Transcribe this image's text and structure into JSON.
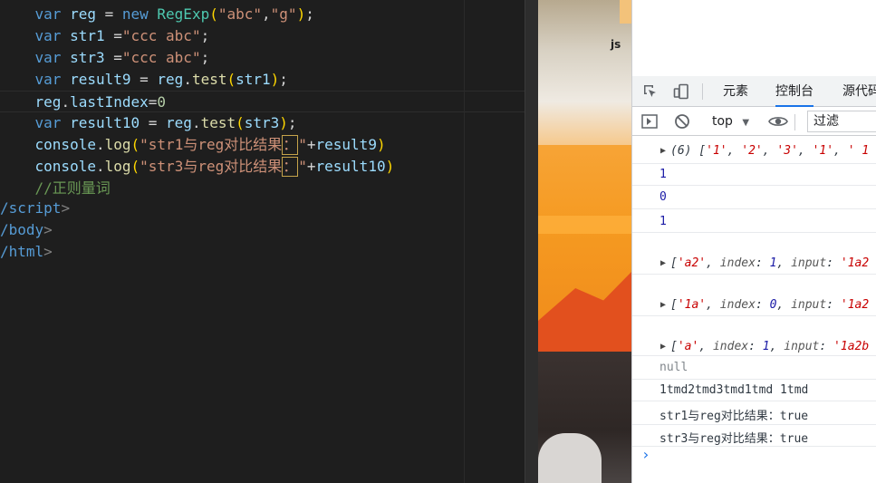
{
  "editor": {
    "lines": [
      {
        "tokens": [
          {
            "t": "    ",
            "c": "ws"
          },
          {
            "t": "var",
            "c": "kw"
          },
          {
            "t": " reg ",
            "c": "var"
          },
          {
            "t": "= ",
            "c": "op"
          },
          {
            "t": "new ",
            "c": "kw"
          },
          {
            "t": "RegExp",
            "c": "cls"
          },
          {
            "t": "(",
            "c": "br"
          },
          {
            "t": "\"abc\"",
            "c": "str"
          },
          {
            "t": ",",
            "c": "op"
          },
          {
            "t": "\"g\"",
            "c": "str"
          },
          {
            "t": ")",
            "c": "br"
          },
          {
            "t": ";",
            "c": "op"
          }
        ]
      },
      {
        "tokens": [
          {
            "t": "    ",
            "c": "ws"
          },
          {
            "t": "var",
            "c": "kw"
          },
          {
            "t": " str1 ",
            "c": "var"
          },
          {
            "t": "=",
            "c": "op"
          },
          {
            "t": "\"ccc abc\"",
            "c": "str"
          },
          {
            "t": ";",
            "c": "op"
          }
        ]
      },
      {
        "tokens": [
          {
            "t": "    ",
            "c": "ws"
          },
          {
            "t": "var",
            "c": "kw"
          },
          {
            "t": " str3 ",
            "c": "var"
          },
          {
            "t": "=",
            "c": "op"
          },
          {
            "t": "\"ccc abc\"",
            "c": "str"
          },
          {
            "t": ";",
            "c": "op"
          }
        ]
      },
      {
        "tokens": [
          {
            "t": "    ",
            "c": "ws"
          },
          {
            "t": "var",
            "c": "kw"
          },
          {
            "t": " result9 ",
            "c": "var"
          },
          {
            "t": "= ",
            "c": "op"
          },
          {
            "t": "reg",
            "c": "var"
          },
          {
            "t": ".",
            "c": "op"
          },
          {
            "t": "test",
            "c": "fn"
          },
          {
            "t": "(",
            "c": "br"
          },
          {
            "t": "str1",
            "c": "var"
          },
          {
            "t": ")",
            "c": "br"
          },
          {
            "t": ";",
            "c": "op"
          }
        ]
      },
      {
        "tokens": [
          {
            "t": "    ",
            "c": "ws"
          },
          {
            "t": "reg",
            "c": "var"
          },
          {
            "t": ".",
            "c": "op"
          },
          {
            "t": "lastIndex",
            "c": "var"
          },
          {
            "t": "=",
            "c": "op"
          },
          {
            "t": "0",
            "c": "num"
          }
        ],
        "current": true
      },
      {
        "tokens": [
          {
            "t": "    ",
            "c": "ws"
          },
          {
            "t": "var",
            "c": "kw"
          },
          {
            "t": " result10 ",
            "c": "var"
          },
          {
            "t": "= ",
            "c": "op"
          },
          {
            "t": "reg",
            "c": "var"
          },
          {
            "t": ".",
            "c": "op"
          },
          {
            "t": "test",
            "c": "fn"
          },
          {
            "t": "(",
            "c": "br"
          },
          {
            "t": "str3",
            "c": "var"
          },
          {
            "t": ")",
            "c": "br"
          },
          {
            "t": ";",
            "c": "op"
          }
        ]
      },
      {
        "tokens": [
          {
            "t": "    ",
            "c": "ws"
          },
          {
            "t": "console",
            "c": "var"
          },
          {
            "t": ".",
            "c": "op"
          },
          {
            "t": "log",
            "c": "fn"
          },
          {
            "t": "(",
            "c": "br"
          },
          {
            "t": "\"str1与reg对比结果",
            "c": "str"
          },
          {
            "t": "：",
            "c": "box"
          },
          {
            "t": "\"",
            "c": "str"
          },
          {
            "t": "+",
            "c": "op"
          },
          {
            "t": "result9",
            "c": "var"
          },
          {
            "t": ")",
            "c": "br"
          }
        ]
      },
      {
        "tokens": [
          {
            "t": "    ",
            "c": "ws"
          },
          {
            "t": "console",
            "c": "var"
          },
          {
            "t": ".",
            "c": "op"
          },
          {
            "t": "log",
            "c": "fn"
          },
          {
            "t": "(",
            "c": "br"
          },
          {
            "t": "\"str3与reg对比结果",
            "c": "str"
          },
          {
            "t": "：",
            "c": "box"
          },
          {
            "t": "\"",
            "c": "str"
          },
          {
            "t": "+",
            "c": "op"
          },
          {
            "t": "result10",
            "c": "var"
          },
          {
            "t": ")",
            "c": "br"
          }
        ]
      },
      {
        "tokens": [
          {
            "t": "    ",
            "c": "ws"
          },
          {
            "t": "//正则量词",
            "c": "cmt"
          }
        ]
      },
      {
        "tokens": [
          {
            "t": "/script",
            "c": "tag"
          },
          {
            "t": ">",
            "c": "tagb"
          }
        ]
      },
      {
        "tokens": [
          {
            "t": "/body",
            "c": "tag"
          },
          {
            "t": ">",
            "c": "tagb"
          }
        ]
      },
      {
        "tokens": [
          {
            "t": "/html",
            "c": "tag"
          },
          {
            "t": ">",
            "c": "tagb"
          }
        ]
      }
    ]
  },
  "preview": {
    "partial_text": "js"
  },
  "devtools": {
    "tabs": [
      {
        "label": "元素",
        "active": false
      },
      {
        "label": "控制台",
        "active": true
      },
      {
        "label": "源代码",
        "active": false
      }
    ],
    "toolbar": {
      "context": "top",
      "context_arrow": "▼",
      "filter_placeholder": "过滤"
    },
    "console": [
      {
        "kind": "expand",
        "segments": [
          {
            "t": "(6) [",
            "c": "arr"
          },
          {
            "t": "'1'",
            "c": "s"
          },
          {
            "t": ", ",
            "c": "arr"
          },
          {
            "t": "'2'",
            "c": "s"
          },
          {
            "t": ", ",
            "c": "arr"
          },
          {
            "t": "'3'",
            "c": "s"
          },
          {
            "t": ", ",
            "c": "arr"
          },
          {
            "t": "'1'",
            "c": "s"
          },
          {
            "t": ", ",
            "c": "arr"
          },
          {
            "t": "' 1",
            "c": "s"
          }
        ]
      },
      {
        "kind": "num",
        "text": "1"
      },
      {
        "kind": "num",
        "text": "0"
      },
      {
        "kind": "num",
        "text": "1"
      },
      {
        "kind": "expand",
        "segments": [
          {
            "t": "[",
            "c": "arr"
          },
          {
            "t": "'a2'",
            "c": "s"
          },
          {
            "t": ", ",
            "c": "arr"
          },
          {
            "t": "index",
            "c": "k"
          },
          {
            "t": ": ",
            "c": "arr"
          },
          {
            "t": "1",
            "c": "num-blue"
          },
          {
            "t": ", ",
            "c": "arr"
          },
          {
            "t": "input",
            "c": "k"
          },
          {
            "t": ": ",
            "c": "arr"
          },
          {
            "t": "'1a2",
            "c": "s"
          }
        ]
      },
      {
        "kind": "expand",
        "segments": [
          {
            "t": "[",
            "c": "arr"
          },
          {
            "t": "'1a'",
            "c": "s"
          },
          {
            "t": ", ",
            "c": "arr"
          },
          {
            "t": "index",
            "c": "k"
          },
          {
            "t": ": ",
            "c": "arr"
          },
          {
            "t": "0",
            "c": "num-blue"
          },
          {
            "t": ", ",
            "c": "arr"
          },
          {
            "t": "input",
            "c": "k"
          },
          {
            "t": ": ",
            "c": "arr"
          },
          {
            "t": "'1a2",
            "c": "s"
          }
        ]
      },
      {
        "kind": "expand",
        "segments": [
          {
            "t": "[",
            "c": "arr"
          },
          {
            "t": "'a'",
            "c": "s"
          },
          {
            "t": ", ",
            "c": "arr"
          },
          {
            "t": "index",
            "c": "k"
          },
          {
            "t": ": ",
            "c": "arr"
          },
          {
            "t": "1",
            "c": "num-blue"
          },
          {
            "t": ", ",
            "c": "arr"
          },
          {
            "t": "input",
            "c": "k"
          },
          {
            "t": ": ",
            "c": "arr"
          },
          {
            "t": "'1a2b",
            "c": "s"
          }
        ]
      },
      {
        "kind": "null",
        "text": "null"
      },
      {
        "kind": "text",
        "text": "1tmd2tmd3tmd1tmd 1tmd"
      },
      {
        "kind": "text",
        "text": "str1与reg对比结果：true"
      },
      {
        "kind": "text",
        "text": "str3与reg对比结果：true"
      }
    ],
    "prompt": "›"
  }
}
